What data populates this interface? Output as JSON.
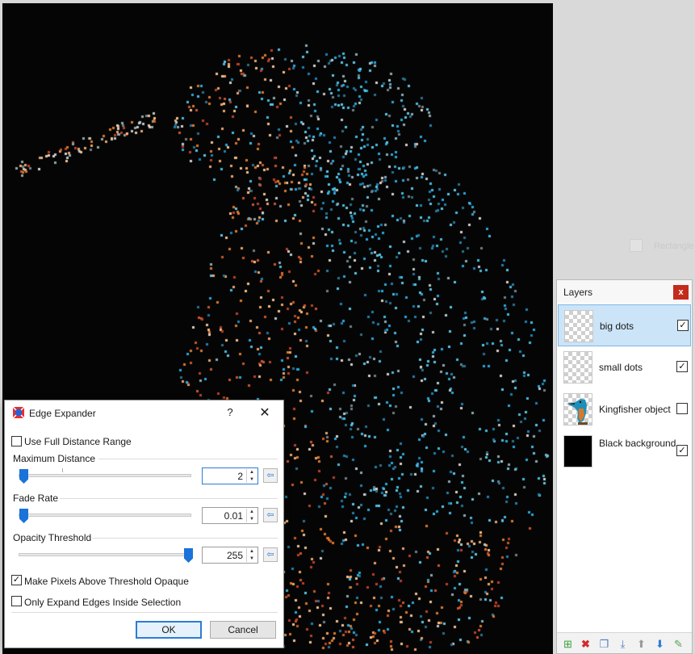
{
  "canvas": {
    "background": "#050505"
  },
  "ghost_tool": {
    "label": "Rectangle"
  },
  "layers_panel": {
    "title": "Layers",
    "close_label": "x",
    "layers": [
      {
        "name": "big dots",
        "visible": true,
        "selected": true,
        "thumb": "checker"
      },
      {
        "name": "small dots",
        "visible": true,
        "selected": false,
        "thumb": "checker"
      },
      {
        "name": "Kingfisher object",
        "visible": false,
        "selected": false,
        "thumb": "kingfisher"
      },
      {
        "name": "Black background",
        "visible": true,
        "selected": false,
        "thumb": "black"
      }
    ],
    "toolbar_icons": [
      "add-layer-icon",
      "delete-layer-icon",
      "duplicate-layer-icon",
      "merge-layer-down-icon",
      "move-layer-up-icon",
      "move-layer-down-icon",
      "layer-properties-icon"
    ]
  },
  "dialog": {
    "title": "Edge Expander",
    "help_label": "?",
    "close_label": "✕",
    "use_full_distance_range": {
      "label": "Use Full Distance Range",
      "checked": false
    },
    "max_distance": {
      "label": "Maximum Distance",
      "value": "2"
    },
    "fade_rate": {
      "label": "Fade Rate",
      "value": "0.01"
    },
    "opacity_threshold": {
      "label": "Opacity Threshold",
      "value": "255"
    },
    "make_opaque": {
      "label": "Make Pixels Above Threshold Opaque",
      "checked": true
    },
    "only_inside_selection": {
      "label": "Only Expand Edges Inside Selection",
      "checked": false
    },
    "ok_label": "OK",
    "cancel_label": "Cancel"
  }
}
